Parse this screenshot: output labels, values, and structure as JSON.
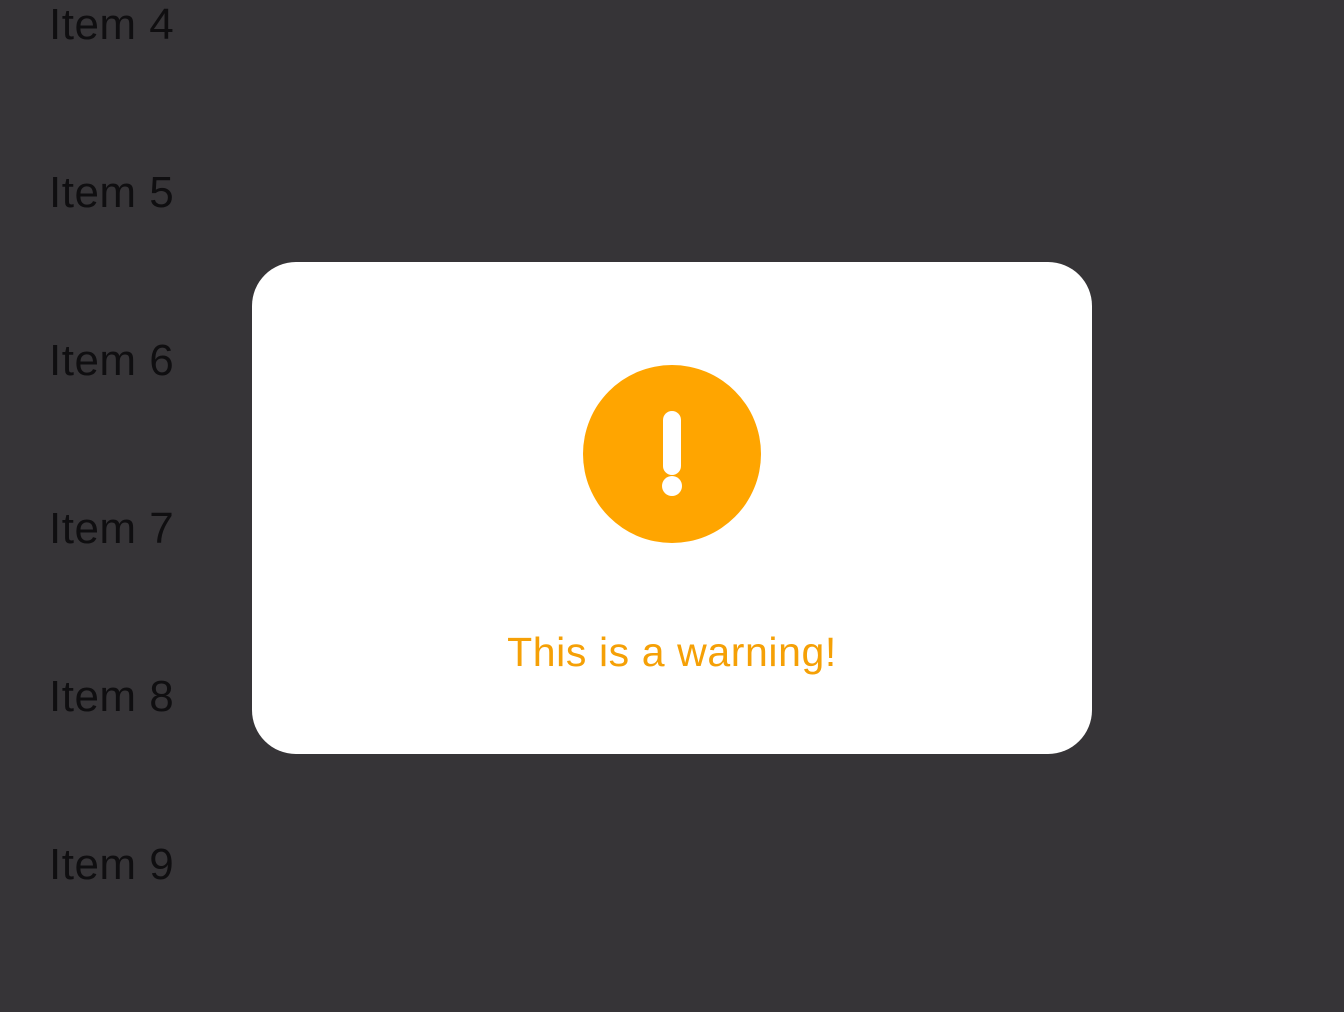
{
  "list": {
    "items": [
      {
        "label": "Item 4"
      },
      {
        "label": "Item 5"
      },
      {
        "label": "Item 6"
      },
      {
        "label": "Item 7"
      },
      {
        "label": "Item 8"
      },
      {
        "label": "Item 9"
      }
    ]
  },
  "dialog": {
    "icon": "warning-exclamation-icon",
    "message": "This is a warning!",
    "accent_color": "#FFA500"
  },
  "colors": {
    "background": "#363437",
    "dialog_background": "#FFFFFF",
    "list_text": "#0F0E10"
  }
}
